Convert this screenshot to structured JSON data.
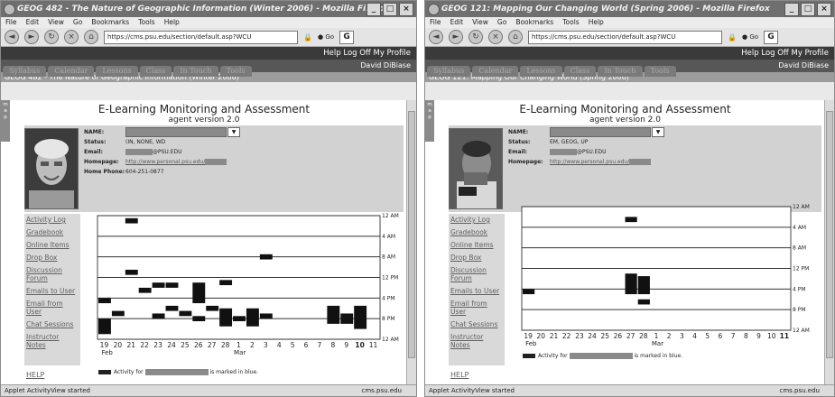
{
  "menu": [
    "File",
    "Edit",
    "View",
    "Go",
    "Bookmarks",
    "Tools",
    "Help"
  ],
  "url": "https://cms.psu.edu/section/default.asp?WCU",
  "go_label": "Go",
  "help_links": "Help  Log Off  My Profile",
  "tabs": [
    "Syllabus",
    "Calendar",
    "Lessons",
    "Class",
    "In Touch",
    "Tools"
  ],
  "app_title": "E-Learning Monitoring and Assessment",
  "agent_version": "agent version 2.0",
  "labels": {
    "name": "NAME:",
    "status": "Status:",
    "email": "Email:",
    "homepage": "Homepage:",
    "phone": "Home Phone:"
  },
  "side_items": [
    "Activity Log",
    "Gradebook",
    "Online Items",
    "Drop Box",
    "Discussion Forum",
    "Emails to User",
    "Email from User",
    "Chat Sessions",
    "Instructor Notes"
  ],
  "help_link": "HELP",
  "legend": {
    "prefix": "Activity for",
    "suffix": "is marked in blue."
  },
  "status_left": "Applet ActivityView started",
  "status_right": "cms.psu.edu",
  "icons": [
    "firefox-icon",
    "back-icon",
    "forward-icon",
    "reload-icon",
    "stop-icon",
    "home-icon",
    "lock-icon",
    "go-icon",
    "google-icon",
    "minimize-icon",
    "maximize-icon",
    "close-icon"
  ],
  "windows": [
    {
      "title": "GEOG 482 - The Nature of Geographic Information (Winter 2006) - Mozilla Firefox",
      "user": "David DiBiase",
      "course": "GEOG 482 - The Nature of Geographic Information (Winter 2006)",
      "status_value": "(IN, NONE, WD",
      "email_value": "@PSU.EDU",
      "homepage_value": "http://www.personal.psu.edu/",
      "phone_value": "604-251-0877",
      "chart_data": {
        "type": "timeline",
        "y_ticks": [
          "12 AM",
          "4 AM",
          "8 AM",
          "12 PM",
          "4 PM",
          "8 PM",
          "12 AM"
        ],
        "x_labels": [
          "19",
          "20",
          "21",
          "22",
          "23",
          "24",
          "25",
          "26",
          "27",
          "28",
          "1",
          "2",
          "3",
          "4",
          "5",
          "6",
          "7",
          "8",
          "9",
          "10",
          "11"
        ],
        "bold_day": "10",
        "month_start": "Feb",
        "month_mid": "Mar",
        "blocks": [
          {
            "day": 2,
            "start": 0.5,
            "end": 1.5
          },
          {
            "day": 2,
            "start": 10.5,
            "end": 11.5
          },
          {
            "day": 12,
            "start": 7.5,
            "end": 8.5
          },
          {
            "day": 0,
            "start": 16,
            "end": 17
          },
          {
            "day": 0,
            "start": 20,
            "end": 23
          },
          {
            "day": 1,
            "start": 18.5,
            "end": 19.5
          },
          {
            "day": 3,
            "start": 14,
            "end": 15
          },
          {
            "day": 4,
            "start": 13,
            "end": 14
          },
          {
            "day": 4,
            "start": 19,
            "end": 20
          },
          {
            "day": 5,
            "start": 13,
            "end": 14
          },
          {
            "day": 5,
            "start": 17.5,
            "end": 18.5
          },
          {
            "day": 6,
            "start": 18.5,
            "end": 19.5
          },
          {
            "day": 7,
            "start": 13,
            "end": 17
          },
          {
            "day": 7,
            "start": 19.5,
            "end": 20.5
          },
          {
            "day": 8,
            "start": 17.5,
            "end": 18.5
          },
          {
            "day": 9,
            "start": 12.5,
            "end": 13.5
          },
          {
            "day": 9,
            "start": 18,
            "end": 21.5
          },
          {
            "day": 10,
            "start": 19.5,
            "end": 20.5
          },
          {
            "day": 11,
            "start": 18,
            "end": 21.5
          },
          {
            "day": 12,
            "start": 19,
            "end": 20
          },
          {
            "day": 17,
            "start": 17.5,
            "end": 21
          },
          {
            "day": 18,
            "start": 19,
            "end": 21
          },
          {
            "day": 19,
            "start": 17.5,
            "end": 22
          }
        ]
      }
    },
    {
      "title": "GEOG 121: Mapping Our Changing World (Spring 2006) - Mozilla Firefox",
      "user": "David DiBiase",
      "course": "GEOG 121: Mapping Our Changing World (Spring 2006)",
      "status_value": "EM, GEOG, UP",
      "email_value": "@PSU.EDU",
      "homepage_value": "http://www.personal.psu.edu/",
      "phone_value": "",
      "chart_data": {
        "type": "timeline",
        "y_ticks": [
          "12 AM",
          "4 AM",
          "8 AM",
          "12 PM",
          "4 PM",
          "8 PM",
          "12 AM"
        ],
        "x_labels": [
          "19",
          "20",
          "21",
          "22",
          "23",
          "24",
          "25",
          "26",
          "27",
          "28",
          "1",
          "2",
          "3",
          "4",
          "5",
          "6",
          "7",
          "8",
          "9",
          "10",
          "11"
        ],
        "bold_day": "11",
        "month_start": "Feb",
        "month_mid": "Mar",
        "blocks": [
          {
            "day": 0,
            "start": 16,
            "end": 17
          },
          {
            "day": 8,
            "start": 2,
            "end": 3
          },
          {
            "day": 8,
            "start": 13,
            "end": 17
          },
          {
            "day": 9,
            "start": 13.5,
            "end": 17
          },
          {
            "day": 9,
            "start": 18,
            "end": 19
          }
        ]
      }
    }
  ]
}
